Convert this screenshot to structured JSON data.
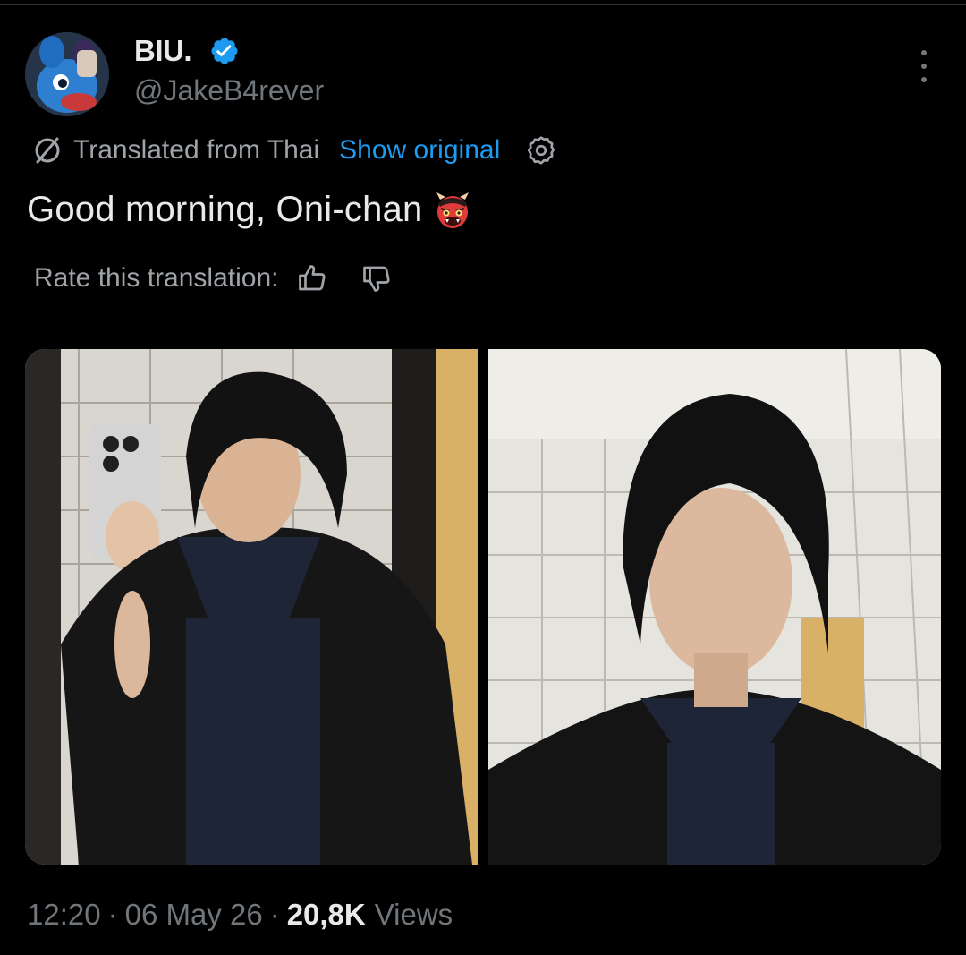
{
  "tweet": {
    "display_name": "BIU.",
    "handle": "@JakeB4rever",
    "verified": true,
    "translation": {
      "translated_from": "Translated from Thai",
      "show_original": "Show original"
    },
    "text": "Good morning, Oni-chan",
    "emoji": "japanese-ogre",
    "rate": {
      "label": "Rate this translation:"
    },
    "media": [
      {
        "description_icon": "photo"
      },
      {
        "description_icon": "photo"
      }
    ],
    "footer": {
      "time": "12:20",
      "date": "06 May 26",
      "views_count": "20,8K",
      "views_label": "Views",
      "separator": "·"
    }
  },
  "colors": {
    "background": "#000000",
    "text": "#e7e9ea",
    "muted": "#71767b",
    "link": "#1d9bf0",
    "verified": "#1d9bf0"
  }
}
